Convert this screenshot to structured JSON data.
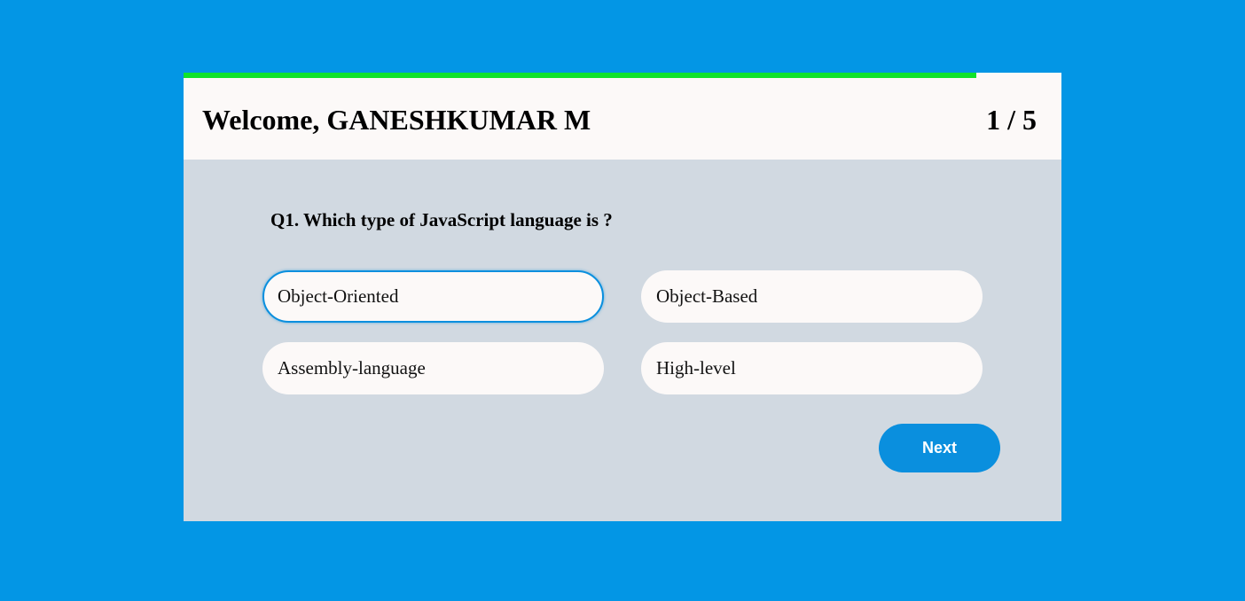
{
  "quiz": {
    "welcome_text": "Welcome, GANESHKUMAR M",
    "counter_text": "1 / 5",
    "progress": 0.903,
    "question": "Q1. Which type of JavaScript language is ?",
    "options": [
      {
        "label": "Object-Oriented",
        "selected": true
      },
      {
        "label": "Object-Based",
        "selected": false
      },
      {
        "label": "Assembly-language",
        "selected": false
      },
      {
        "label": "High-level",
        "selected": false
      }
    ],
    "next_label": "Next"
  },
  "colors": {
    "background": "#0396e5",
    "card": "#d1d9e1",
    "header": "#fcf9f8",
    "progress": "#10e32b",
    "accent": "#0a8fde"
  }
}
